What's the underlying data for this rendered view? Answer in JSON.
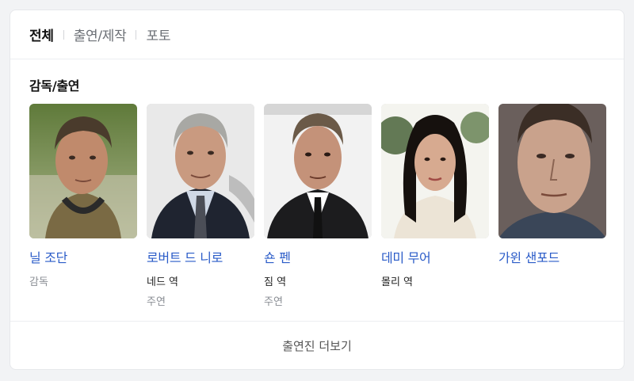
{
  "tabs": [
    {
      "label": "전체",
      "active": true
    },
    {
      "label": "출연/제작",
      "active": false
    },
    {
      "label": "포토",
      "active": false
    }
  ],
  "section": {
    "title": "감독/출연"
  },
  "people": [
    {
      "name": "닐 조단",
      "role": "감독",
      "role_type": ""
    },
    {
      "name": "로버트 드 니로",
      "role": "네드 역",
      "role_type": "주연"
    },
    {
      "name": "숀 펜",
      "role": "짐 역",
      "role_type": "주연"
    },
    {
      "name": "데미 무어",
      "role": "몰리 역",
      "role_type": ""
    },
    {
      "name": "가윈 샌포드",
      "role": "",
      "role_type": ""
    }
  ],
  "more_button": {
    "label": "출연진 더보기"
  },
  "colors": {
    "link": "#2a5bc8",
    "muted": "#8a8e94"
  }
}
